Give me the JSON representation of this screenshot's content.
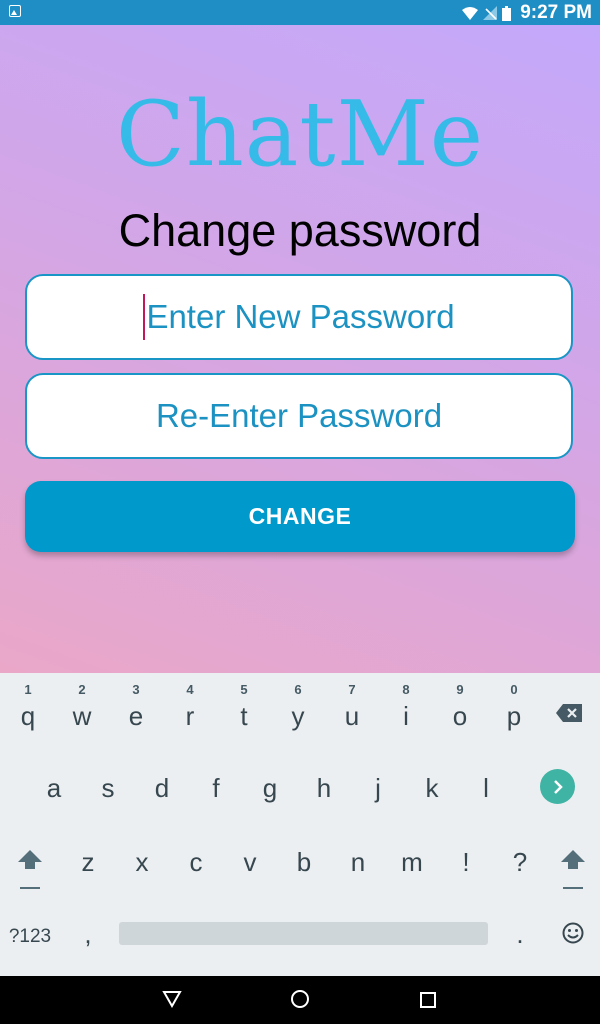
{
  "status_bar": {
    "time": "9:27 PM",
    "icons": [
      "image-icon",
      "wifi-icon",
      "signal-icon",
      "battery-icon"
    ]
  },
  "app": {
    "logo": "ChatMe",
    "subtitle": "Change password",
    "new_password_placeholder": "Enter New Password",
    "reenter_password_placeholder": "Re-Enter Password",
    "change_button": "CHANGE",
    "colors": {
      "logo": "#36bbe8",
      "field_text": "#1c92c2",
      "button": "#0099cc"
    }
  },
  "keyboard": {
    "row1": [
      {
        "key": "q",
        "hint": "1"
      },
      {
        "key": "w",
        "hint": "2"
      },
      {
        "key": "e",
        "hint": "3"
      },
      {
        "key": "r",
        "hint": "4"
      },
      {
        "key": "t",
        "hint": "5"
      },
      {
        "key": "y",
        "hint": "6"
      },
      {
        "key": "u",
        "hint": "7"
      },
      {
        "key": "i",
        "hint": "8"
      },
      {
        "key": "o",
        "hint": "9"
      },
      {
        "key": "p",
        "hint": "0"
      }
    ],
    "row2": [
      "a",
      "s",
      "d",
      "f",
      "g",
      "h",
      "j",
      "k",
      "l"
    ],
    "row3": [
      "z",
      "x",
      "c",
      "v",
      "b",
      "n",
      "m",
      "!",
      "?"
    ],
    "symbols_key": "?123",
    "comma_key": ",",
    "period_key": ".",
    "icons": [
      "backspace-icon",
      "go-icon",
      "shift-icon",
      "emoji-icon"
    ]
  },
  "nav_bar": {
    "icons": [
      "back-icon",
      "home-icon",
      "recents-icon"
    ]
  }
}
